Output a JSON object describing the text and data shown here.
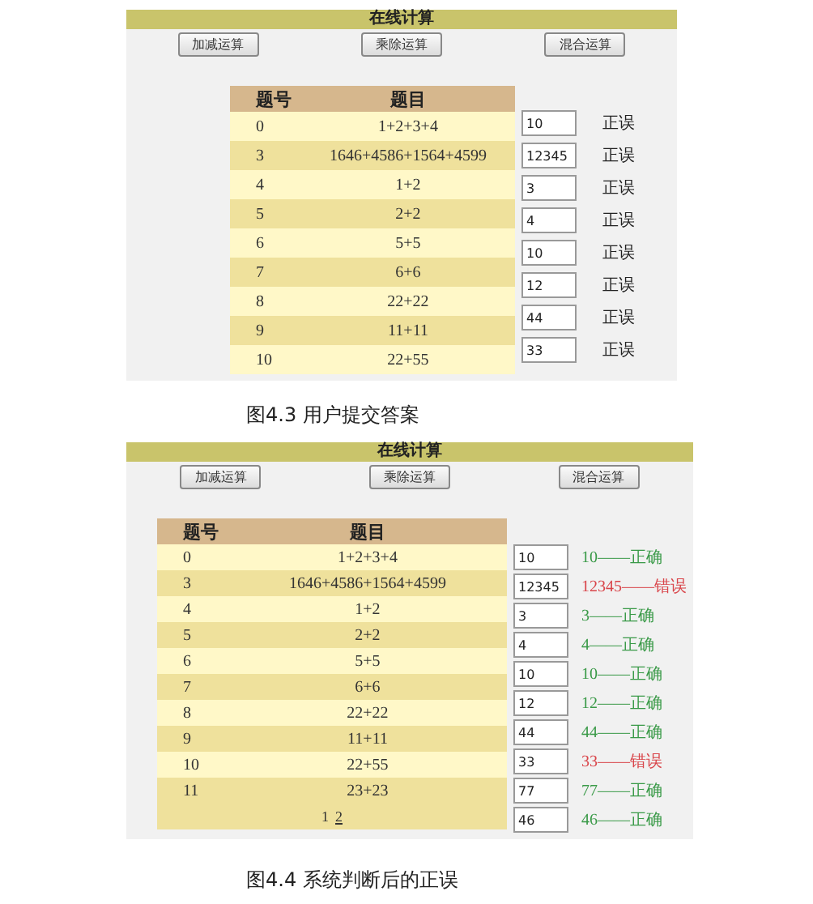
{
  "figures": [
    {
      "panel": {
        "title": "在线计算",
        "buttons": [
          "加减运算",
          "乘除运算",
          "混合运算"
        ],
        "table": {
          "columns": [
            "题号",
            "题目"
          ],
          "rows": [
            {
              "no": "0",
              "question": "1+2+3+4"
            },
            {
              "no": "3",
              "question": "1646+4586+1564+4599"
            },
            {
              "no": "4",
              "question": "1+2"
            },
            {
              "no": "5",
              "question": "2+2"
            },
            {
              "no": "6",
              "question": "5+5"
            },
            {
              "no": "7",
              "question": "6+6"
            },
            {
              "no": "8",
              "question": "22+22"
            },
            {
              "no": "9",
              "question": "11+11"
            },
            {
              "no": "10",
              "question": "22+55"
            }
          ]
        },
        "answers": [
          {
            "value": "10",
            "kind": "pending",
            "result": "正误"
          },
          {
            "value": "12345",
            "kind": "pending",
            "result": "正误"
          },
          {
            "value": "3",
            "kind": "pending",
            "result": "正误"
          },
          {
            "value": "4",
            "kind": "pending",
            "result": "正误"
          },
          {
            "value": "10",
            "kind": "pending",
            "result": "正误"
          },
          {
            "value": "12",
            "kind": "pending",
            "result": "正误"
          },
          {
            "value": "44",
            "kind": "pending",
            "result": "正误"
          },
          {
            "value": "33",
            "kind": "pending",
            "result": "正误"
          }
        ]
      },
      "caption": "图4.3  用户提交答案"
    },
    {
      "panel": {
        "title": "在线计算",
        "buttons": [
          "加减运算",
          "乘除运算",
          "混合运算"
        ],
        "table": {
          "columns": [
            "题号",
            "题目"
          ],
          "rows": [
            {
              "no": "0",
              "question": "1+2+3+4"
            },
            {
              "no": "3",
              "question": "1646+4586+1564+4599"
            },
            {
              "no": "4",
              "question": "1+2"
            },
            {
              "no": "5",
              "question": "2+2"
            },
            {
              "no": "6",
              "question": "5+5"
            },
            {
              "no": "7",
              "question": "6+6"
            },
            {
              "no": "8",
              "question": "22+22"
            },
            {
              "no": "9",
              "question": "11+11"
            },
            {
              "no": "10",
              "question": "22+55"
            },
            {
              "no": "11",
              "question": "23+23"
            }
          ],
          "pager": [
            {
              "label": "1",
              "selected": true
            },
            {
              "label": "2",
              "selected": false
            }
          ]
        },
        "answers": [
          {
            "value": "10",
            "kind": "judged",
            "correct": true,
            "result": "10——正确"
          },
          {
            "value": "12345",
            "kind": "judged",
            "correct": false,
            "result": "12345——错误"
          },
          {
            "value": "3",
            "kind": "judged",
            "correct": true,
            "result": "3——正确"
          },
          {
            "value": "4",
            "kind": "judged",
            "correct": true,
            "result": "4——正确"
          },
          {
            "value": "10",
            "kind": "judged",
            "correct": true,
            "result": "10——正确"
          },
          {
            "value": "12",
            "kind": "judged",
            "correct": true,
            "result": "12——正确"
          },
          {
            "value": "44",
            "kind": "judged",
            "correct": true,
            "result": "44——正确"
          },
          {
            "value": "33",
            "kind": "judged",
            "correct": false,
            "result": "33——错误"
          },
          {
            "value": "77",
            "kind": "judged",
            "correct": true,
            "result": "77——正确"
          },
          {
            "value": "46",
            "kind": "judged",
            "correct": true,
            "result": "46——正确"
          }
        ]
      },
      "caption": "图4.4  系统判断后的正误"
    }
  ]
}
